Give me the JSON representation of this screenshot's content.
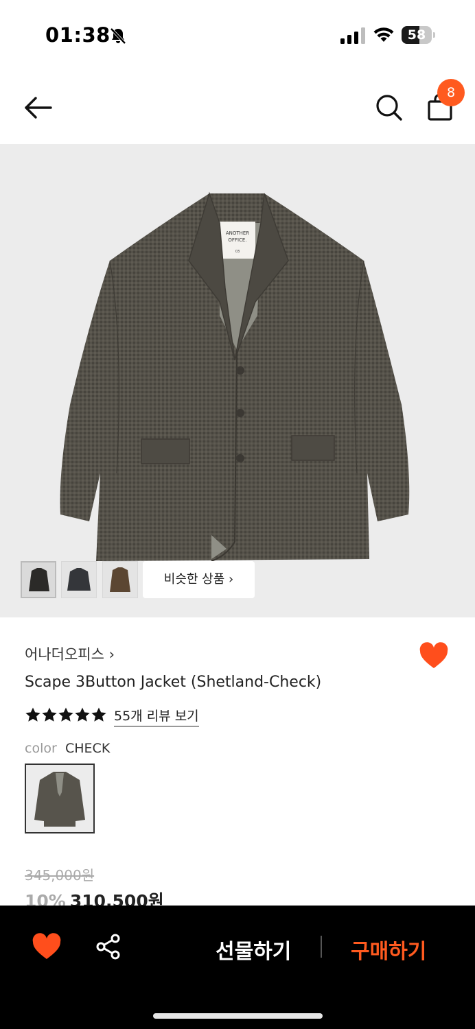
{
  "status_bar": {
    "time": "01:38",
    "battery": "58",
    "battery_level": 0.58
  },
  "nav": {
    "cart_count": "8"
  },
  "gallery": {
    "similar_label": "비슷한 상품 ›"
  },
  "product": {
    "brand": "어나더오피스 ›",
    "name": "Scape 3Button Jacket (Shetland-Check)",
    "rating_stars": 5,
    "review_link": "55개 리뷰 보기",
    "color_label": "color",
    "color_value": "CHECK",
    "original_price": "345,000원",
    "discount": "10%",
    "final_price": "310,500원"
  },
  "bottom_bar": {
    "gift_label": "선물하기",
    "buy_label": "구매하기"
  },
  "colors": {
    "accent": "#ff5a1f",
    "bottom_bar_bg": "#000000",
    "jacket": "#55524a"
  }
}
